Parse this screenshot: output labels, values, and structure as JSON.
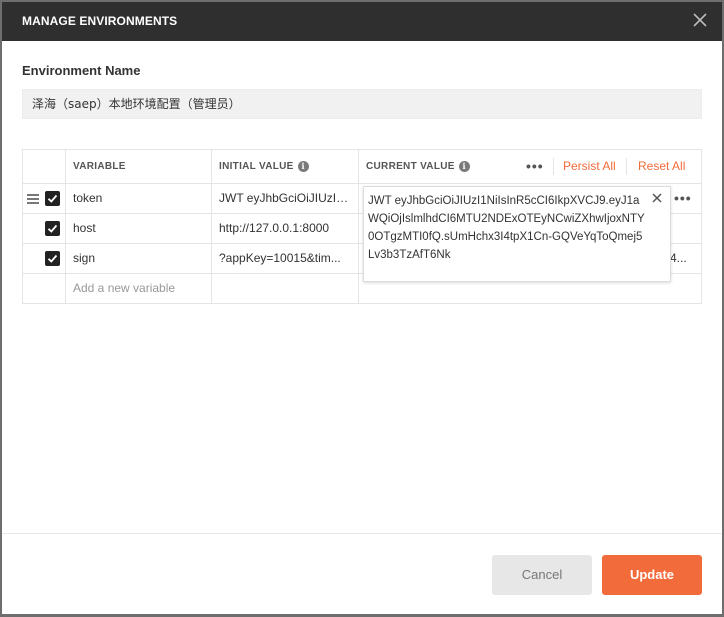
{
  "dialog": {
    "title": "MANAGE ENVIRONMENTS"
  },
  "environment": {
    "label": "Environment Name",
    "value": "泽海（saep）本地环境配置（管理员）"
  },
  "table": {
    "headers": {
      "variable": "VARIABLE",
      "initial_value": "INITIAL VALUE",
      "current_value": "CURRENT VALUE",
      "persist_all": "Persist All",
      "reset_all": "Reset All"
    },
    "rows": [
      {
        "checked": true,
        "variable": "token",
        "initial": "JWT eyJhbGciOiJIUzI1...",
        "current": ""
      },
      {
        "checked": true,
        "variable": "host",
        "initial": "http://127.0.0.1:8000",
        "current": ""
      },
      {
        "checked": true,
        "variable": "sign",
        "initial": "?appKey=10015&tim...",
        "current": "4..."
      }
    ],
    "new_variable_placeholder": "Add a new variable"
  },
  "popup": {
    "value": "JWT eyJhbGciOiJIUzI1NiIsInR5cCI6IkpXVCJ9.eyJ1aWQiOjIslmlhdCI6MTU2NDExOTEyNCwiZXhwIjoxNTY0OTgzMTI0fQ.sUmHchx3I4tpX1Cn-GQVeYqToQmej5Lv3b3TzAfT6Nk"
  },
  "footer": {
    "cancel_label": "Cancel",
    "update_label": "Update"
  },
  "colors": {
    "accent": "#f26b3a",
    "header_bg": "#2f2f2f"
  }
}
